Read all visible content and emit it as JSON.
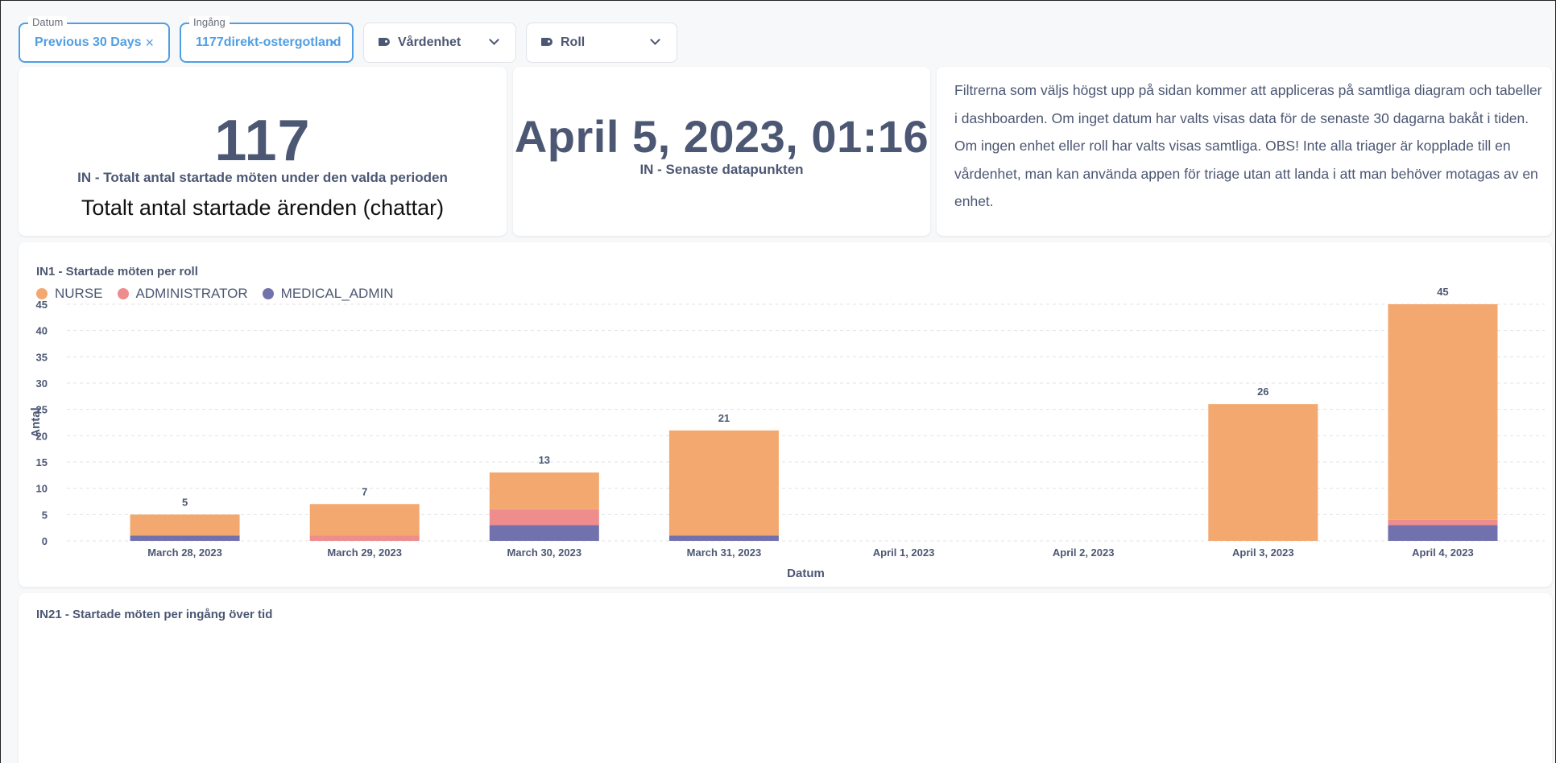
{
  "filters": {
    "datum": {
      "label": "Datum",
      "value": "Previous 30 Days",
      "clear": "×"
    },
    "ingang": {
      "label": "Ingång",
      "value": "1177direkt-ostergotland",
      "clear": "×"
    },
    "vardenhet": {
      "placeholder": "Vårdenhet"
    },
    "roll": {
      "placeholder": "Roll"
    }
  },
  "total_card": {
    "value": "117",
    "subtitle": "IN - Totalt antal startade möten under den valda perioden",
    "note": "Totalt antal startade ärenden (chattar)"
  },
  "latest_card": {
    "value": "April 5, 2023, 01:16",
    "subtitle": "IN - Senaste datapunkten"
  },
  "info_card": {
    "text": "Filtrerna som väljs högst upp på sidan kommer att appliceras på samtliga diagram och tabeller i dashboarden. Om inget datum har valts visas data för de senaste 30 dagarna bakåt i tiden. Om ingen enhet eller roll har valts visas samtliga. OBS! Inte alla triager är kopplade till en vårdenhet, man kan använda appen för triage utan att landa i att man behöver motagas av en enhet."
  },
  "chart_card": {
    "title": "IN1 - Startade möten per roll"
  },
  "bottom_card": {
    "title": "IN21 - Startade möten per ingång över tid"
  },
  "colors": {
    "nurse": "#f2a86f",
    "administrator": "#ef8c8c",
    "medical_admin": "#7172ad",
    "active_filter": "#509ee3"
  },
  "chart_data": {
    "type": "bar",
    "stacked": true,
    "xlabel": "Datum",
    "ylabel": "Antal",
    "ylim": [
      0,
      45
    ],
    "yticks": [
      0,
      5,
      10,
      15,
      20,
      25,
      30,
      35,
      40,
      45
    ],
    "categories": [
      "March 28, 2023",
      "March 29, 2023",
      "March 30, 2023",
      "March 31, 2023",
      "April 1, 2023",
      "April 2, 2023",
      "April 3, 2023",
      "April 4, 2023"
    ],
    "series": [
      {
        "name": "MEDICAL_ADMIN",
        "color": "#7172ad",
        "values": [
          1,
          0,
          3,
          1,
          0,
          0,
          0,
          3
        ]
      },
      {
        "name": "ADMINISTRATOR",
        "color": "#ef8c8c",
        "values": [
          0,
          1,
          3,
          0,
          0,
          0,
          0,
          1
        ]
      },
      {
        "name": "NURSE",
        "color": "#f2a86f",
        "values": [
          4,
          6,
          7,
          20,
          0,
          0,
          26,
          41
        ]
      }
    ],
    "legend_order": [
      "NURSE",
      "ADMINISTRATOR",
      "MEDICAL_ADMIN"
    ],
    "totals": [
      5,
      7,
      13,
      21,
      0,
      0,
      26,
      45
    ],
    "grid": true,
    "legend_position": "top-left"
  }
}
